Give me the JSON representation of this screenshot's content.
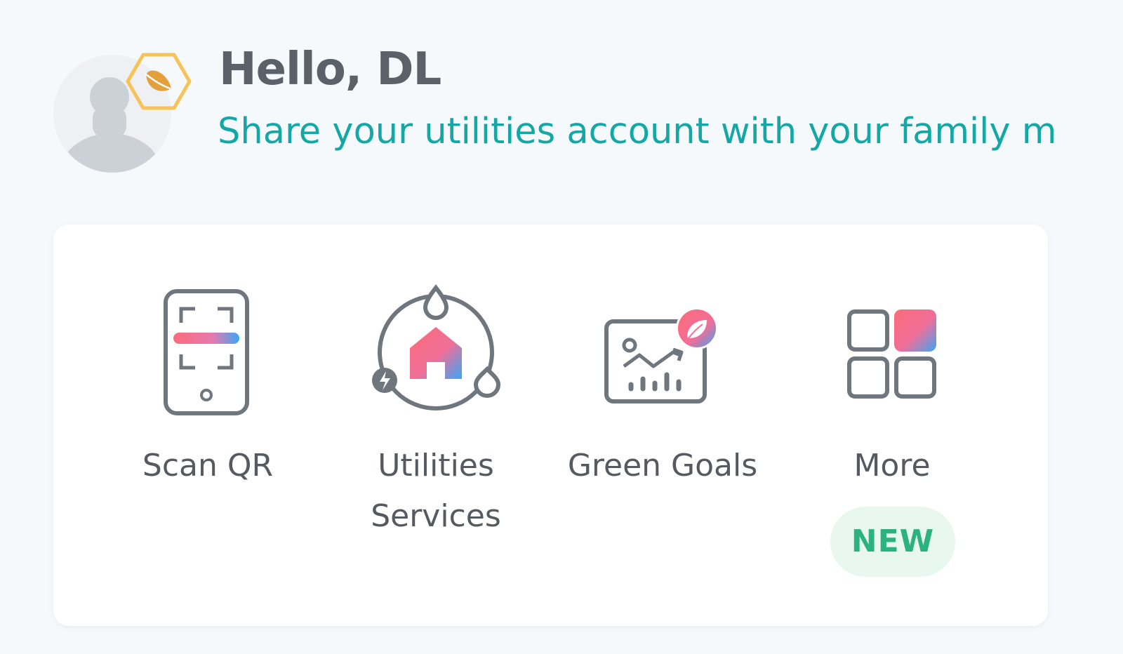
{
  "header": {
    "greeting": "Hello, DL",
    "share_text": "Share your utilities account with your family members"
  },
  "profile": {
    "avatar_icon": "user-placeholder-icon",
    "level_badge_icon": "leaf-hexagon-icon"
  },
  "quick_actions": [
    {
      "label": "Scan QR",
      "icon": "scan-qr-icon"
    },
    {
      "label": "Utilities Services",
      "icon": "utilities-services-icon"
    },
    {
      "label": "Green Goals",
      "icon": "green-goals-icon"
    },
    {
      "label": "More",
      "icon": "more-grid-icon",
      "badge": "NEW"
    }
  ],
  "colors": {
    "background": "#f6f9fb",
    "accent_teal": "#14a7a5",
    "badge_green": "#2bb27e",
    "badge_bg": "#e9f7f1",
    "hexagon_gold": "#f6c35a"
  }
}
